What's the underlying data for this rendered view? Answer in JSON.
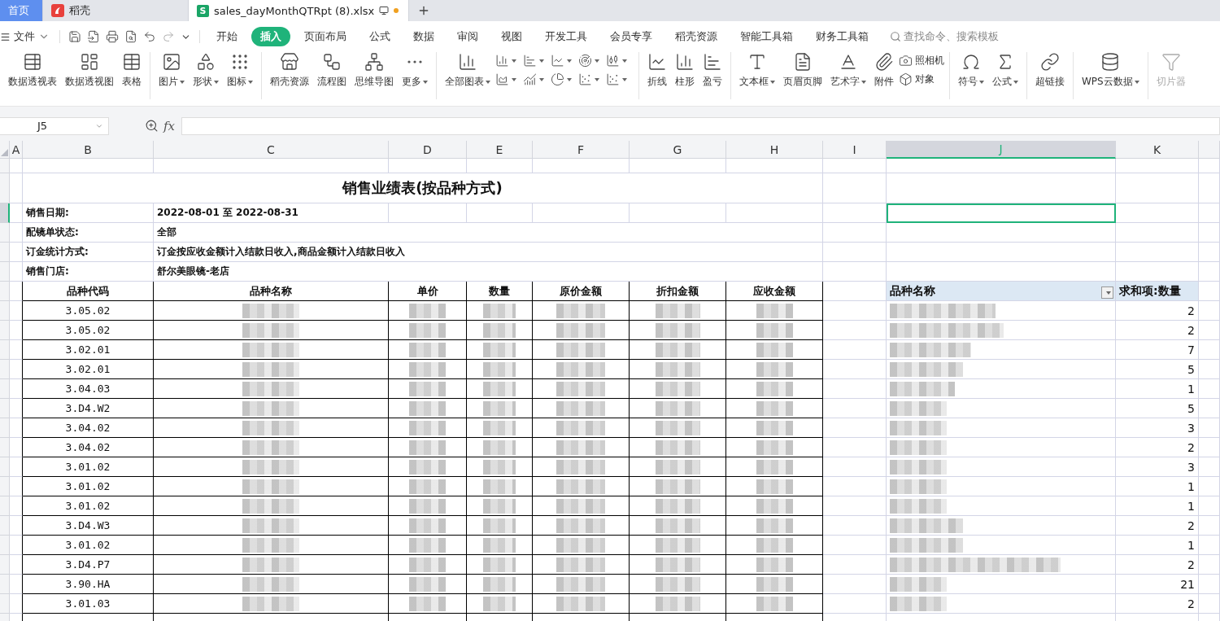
{
  "tabs": [
    {
      "label": "首页",
      "selected": false,
      "kind": "home"
    },
    {
      "label": "稻壳",
      "selected": false,
      "kind": "docer"
    },
    {
      "label": "sales_dayMonthQTRpt (8).xlsx",
      "selected": true,
      "kind": "sheet",
      "logo": "S",
      "unsaved": true
    }
  ],
  "menu": {
    "file": "文件",
    "items": [
      {
        "label": "开始",
        "selected": false
      },
      {
        "label": "插入",
        "selected": true
      },
      {
        "label": "页面布局",
        "selected": false
      },
      {
        "label": "公式",
        "selected": false
      },
      {
        "label": "数据",
        "selected": false
      },
      {
        "label": "审阅",
        "selected": false
      },
      {
        "label": "视图",
        "selected": false
      },
      {
        "label": "开发工具",
        "selected": false
      },
      {
        "label": "会员专享",
        "selected": false
      },
      {
        "label": "稻壳资源",
        "selected": false
      },
      {
        "label": "智能工具箱",
        "selected": false
      },
      {
        "label": "财务工具箱",
        "selected": false
      }
    ],
    "search_placeholder": "查找命令、搜索模板"
  },
  "ribbon": [
    {
      "items": [
        {
          "kind": "large",
          "label": "数据透视表",
          "dropdown": false,
          "disabled": false
        },
        {
          "kind": "large",
          "label": "数据透视图",
          "dropdown": false,
          "disabled": false
        },
        {
          "kind": "large",
          "label": "表格",
          "dropdown": false,
          "disabled": false
        }
      ]
    },
    {
      "items": [
        {
          "kind": "large",
          "label": "图片",
          "dropdown": true,
          "disabled": false
        },
        {
          "kind": "large",
          "label": "形状",
          "dropdown": true,
          "disabled": false
        },
        {
          "kind": "large",
          "label": "图标",
          "dropdown": true,
          "disabled": false
        }
      ]
    },
    {
      "items": [
        {
          "kind": "large",
          "label": "稻壳资源",
          "dropdown": false,
          "disabled": false
        },
        {
          "kind": "large",
          "label": "流程图",
          "dropdown": false,
          "disabled": false
        },
        {
          "kind": "large",
          "label": "思维导图",
          "dropdown": false,
          "disabled": false
        },
        {
          "kind": "large",
          "label": "更多",
          "dropdown": true,
          "disabled": false
        }
      ]
    },
    {
      "items": [
        {
          "kind": "large",
          "label": "全部图表",
          "dropdown": true,
          "disabled": false
        },
        {
          "kind": "icon-grid"
        }
      ]
    },
    {
      "items": [
        {
          "kind": "large",
          "label": "折线",
          "dropdown": false,
          "disabled": false
        },
        {
          "kind": "large",
          "label": "柱形",
          "dropdown": false,
          "disabled": false
        },
        {
          "kind": "large",
          "label": "盈亏",
          "dropdown": false,
          "disabled": false
        }
      ]
    },
    {
      "items": [
        {
          "kind": "large",
          "label": "文本框",
          "dropdown": true,
          "disabled": false
        },
        {
          "kind": "large",
          "label": "页眉页脚",
          "dropdown": false,
          "disabled": false
        },
        {
          "kind": "large",
          "label": "艺术字",
          "dropdown": true,
          "disabled": false
        },
        {
          "kind": "large",
          "label": "附件",
          "dropdown": false,
          "disabled": false
        },
        {
          "kind": "stack",
          "buttons": [
            "照相机",
            "对象"
          ]
        }
      ]
    },
    {
      "items": [
        {
          "kind": "large",
          "label": "符号",
          "dropdown": true,
          "disabled": false
        },
        {
          "kind": "large",
          "label": "公式",
          "dropdown": true,
          "disabled": false
        }
      ]
    },
    {
      "items": [
        {
          "kind": "large",
          "label": "超链接",
          "dropdown": false,
          "disabled": false
        }
      ]
    },
    {
      "items": [
        {
          "kind": "large",
          "label": "WPS云数据",
          "dropdown": true,
          "disabled": false
        }
      ]
    },
    {
      "items": [
        {
          "kind": "large",
          "label": "切片器",
          "dropdown": false,
          "disabled": true
        }
      ]
    }
  ],
  "formula_bar": {
    "cell_ref": "J5",
    "fx": "fx"
  },
  "sheet": {
    "columns": [
      {
        "label": "A",
        "selected": false
      },
      {
        "label": "B",
        "selected": false
      },
      {
        "label": "C",
        "selected": false
      },
      {
        "label": "D",
        "selected": false
      },
      {
        "label": "E",
        "selected": false
      },
      {
        "label": "F",
        "selected": false
      },
      {
        "label": "G",
        "selected": false
      },
      {
        "label": "H",
        "selected": false
      },
      {
        "label": "I",
        "selected": false
      },
      {
        "label": "J",
        "selected": true
      },
      {
        "label": "K",
        "selected": false
      }
    ],
    "title": "销售业绩表(按品种方式)",
    "info": [
      {
        "label": "销售日期:",
        "value": "2022-08-01  至  2022-08-31",
        "selected": true
      },
      {
        "label": "配镜单状态:",
        "value": "全部",
        "selected": false
      },
      {
        "label": "订金统计方式:",
        "value": "订金按应收金额计入结款日收入,商品金额计入结款日收入",
        "selected": false
      },
      {
        "label": "销售门店:",
        "value": "舒尔美眼镜-老店",
        "selected": false
      }
    ],
    "table_headers": [
      "品种代码",
      "品种名称",
      "单价",
      "数量",
      "原价金额",
      "折扣金额",
      "应收金额"
    ],
    "rows": [
      {
        "code": "3.05.02"
      },
      {
        "code": "3.05.02"
      },
      {
        "code": "3.02.01"
      },
      {
        "code": "3.02.01"
      },
      {
        "code": "3.04.03"
      },
      {
        "code": "3.D4.W2"
      },
      {
        "code": "3.04.02"
      },
      {
        "code": "3.04.02"
      },
      {
        "code": "3.01.02"
      },
      {
        "code": "3.01.02"
      },
      {
        "code": "3.01.02"
      },
      {
        "code": "3.D4.W3"
      },
      {
        "code": "3.01.02"
      },
      {
        "code": "3.D4.P7"
      },
      {
        "code": "3.90.HA"
      },
      {
        "code": "3.01.03"
      }
    ],
    "pivot": {
      "row_header": "品种名称",
      "value_header": "求和项:数量",
      "values": [
        "2",
        "2",
        "7",
        "5",
        "1",
        "5",
        "3",
        "2",
        "3",
        "1",
        "1",
        "2",
        "1",
        "2",
        "21",
        "2"
      ]
    }
  }
}
